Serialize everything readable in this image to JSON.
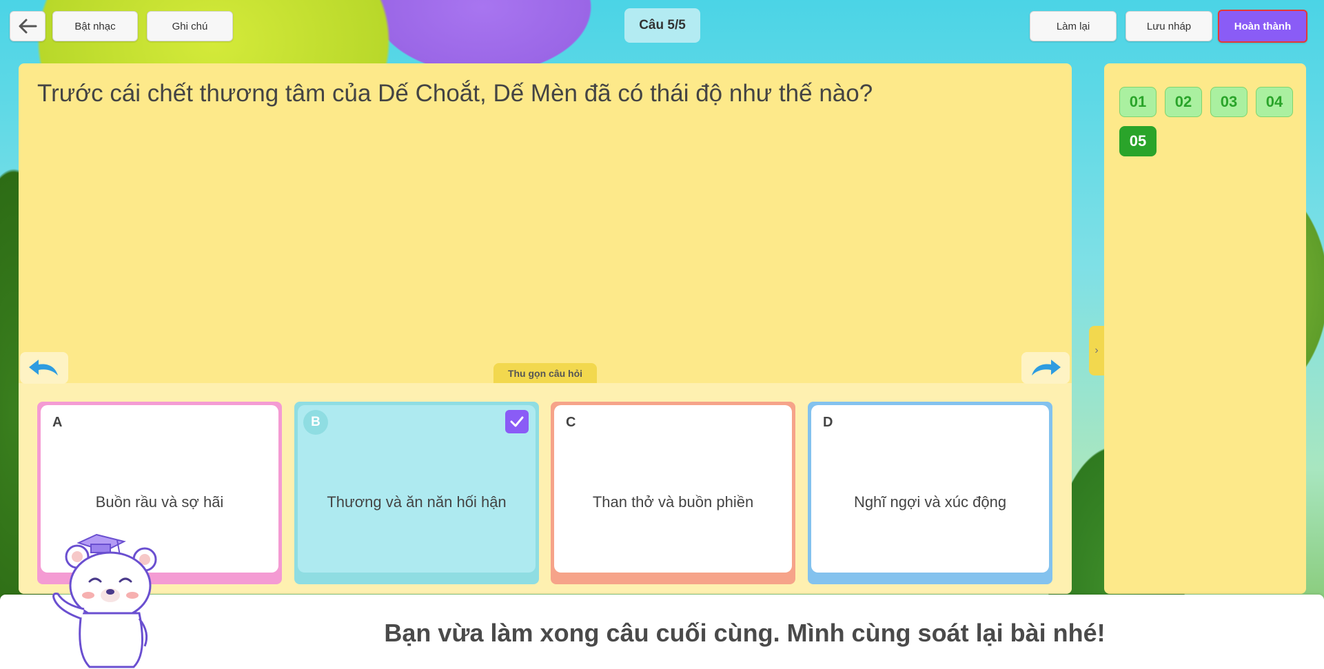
{
  "toolbar": {
    "back_icon": "arrow-left-icon",
    "music_label": "Bật nhạc",
    "notes_label": "Ghi chú",
    "counter": "Câu 5/5",
    "redo_label": "Làm lại",
    "save_draft_label": "Lưu nháp",
    "finish_label": "Hoàn thành"
  },
  "question": {
    "text": "Trước cái chết thương tâm của Dế Choắt, Dế Mèn đã có thái độ như thế nào?",
    "collapse_label": "Thu gọn câu hỏi"
  },
  "answers": [
    {
      "letter": "A",
      "text": "Buồn rầu và sợ hãi",
      "selected": false
    },
    {
      "letter": "B",
      "text": "Thương và ăn năn hối hận",
      "selected": true
    },
    {
      "letter": "C",
      "text": "Than thở và buồn phiền",
      "selected": false
    },
    {
      "letter": "D",
      "text": "Nghĩ ngợi và xúc động",
      "selected": false
    }
  ],
  "navigator": {
    "items": [
      "01",
      "02",
      "03",
      "04",
      "05"
    ],
    "active": "05",
    "toggle_icon": "chevron-right-icon"
  },
  "banner": {
    "message": "Bạn vừa làm xong câu cuối cùng. Mình cùng soát lại bài nhé!"
  },
  "colors": {
    "accent": "#8a5cf6",
    "question_bg": "#fde98a",
    "nav_active": "#2aa42a"
  }
}
